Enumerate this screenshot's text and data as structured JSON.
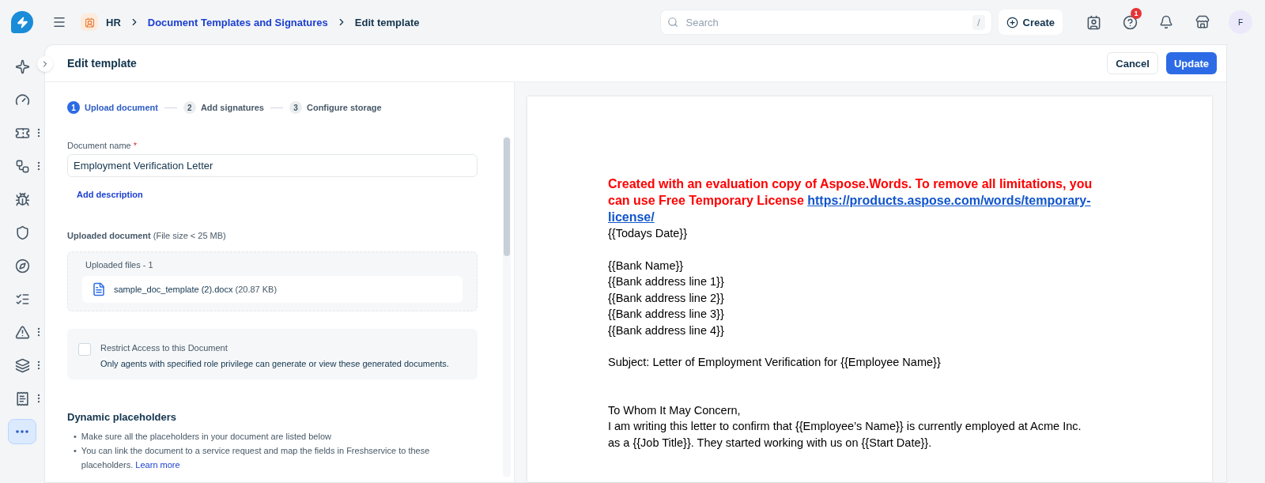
{
  "topbar": {
    "breadcrumb": [
      {
        "label": "HR",
        "kind": "module"
      },
      {
        "label": "Document Templates and Signatures",
        "kind": "link"
      },
      {
        "label": "Edit template",
        "kind": "current"
      }
    ],
    "search": {
      "placeholder": "Search",
      "shortcut": "/"
    },
    "create_button": "Create",
    "help_badge": "1",
    "avatar": "F"
  },
  "sidebar": {
    "items": [
      {
        "menu": false,
        "selected": false
      },
      {
        "menu": false,
        "selected": false
      },
      {
        "menu": true,
        "selected": false
      },
      {
        "menu": true,
        "selected": false
      },
      {
        "menu": false,
        "selected": false
      },
      {
        "menu": false,
        "selected": false
      },
      {
        "menu": false,
        "selected": false
      },
      {
        "menu": false,
        "selected": false
      },
      {
        "menu": true,
        "selected": false
      },
      {
        "menu": true,
        "selected": false
      },
      {
        "menu": true,
        "selected": false
      },
      {
        "menu": false,
        "selected": true
      }
    ]
  },
  "header": {
    "title": "Edit template",
    "cancel": "Cancel",
    "update": "Update"
  },
  "steps": [
    {
      "number": "1",
      "label": "Upload document",
      "selected": true
    },
    {
      "number": "2",
      "label": "Add signatures",
      "selected": false
    },
    {
      "number": "3",
      "label": "Configure storage",
      "selected": false
    }
  ],
  "form": {
    "name_label": "Document name",
    "required_mark": "*",
    "name_value": "Employment Verification Letter",
    "add_description": "Add description",
    "uploaded_label": "**Uploaded document** (File size < 25 MB)",
    "uploaded_count": "Uploaded files - 1",
    "file_name": "sample_doc_template (2).docx",
    "file_size": "(20.87 KB)",
    "restrict": {
      "label": "Restrict Access to this Document",
      "checked": false,
      "hint": "Only agents with specified role privilege can generate or view these generated documents."
    },
    "placeholders_title": "Dynamic placeholders",
    "bullets": [
      {
        "marker": "•",
        "text": "Make sure all the placeholders in your document are listed below"
      },
      {
        "marker": "•",
        "text": "You can link the document to a service request and map the fields in Freshservice to these placeholders.",
        "link": "Learn more"
      }
    ]
  },
  "document": {
    "notice": "Created with an evaluation copy of Aspose.Words. To remove all limitations, you can use Free Temporary License",
    "notice_link_lines": [
      "https://products.aspose.com/words/temporary-",
      "license/"
    ],
    "blocks": [
      [
        "{{Todays Date}}"
      ],
      [
        "{{Bank Name}}",
        "{{Bank address line 1}}",
        "{{Bank address line 2}}",
        "{{Bank address line 3}}",
        "{{Bank address line 4}}"
      ],
      [
        "Subject: Letter of Employment Verification for {{Employee Name}}"
      ],
      [
        "To Whom It May Concern,",
        "I am writing this letter to confirm that {{Employee’s Name}} is currently employed at Acme Inc. as a {{Job Title}}. They started working with us on {{Start Date}}."
      ]
    ]
  }
}
